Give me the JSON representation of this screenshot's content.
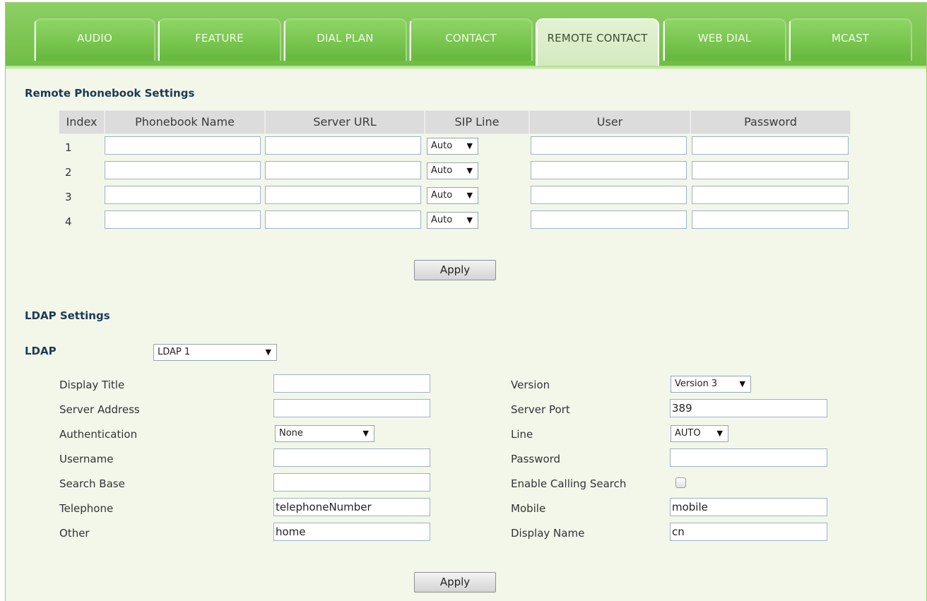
{
  "tabs": [
    "AUDIO",
    "FEATURE",
    "DIAL PLAN",
    "CONTACT",
    "REMOTE CONTACT",
    "WEB DIAL",
    "MCAST"
  ],
  "active_tab": "REMOTE CONTACT",
  "remote_phonebook": {
    "title": "Remote Phonebook Settings",
    "columns": [
      "Index",
      "Phonebook Name",
      "Server URL",
      "SIP Line",
      "User",
      "Password"
    ],
    "rows": [
      {
        "index": "1",
        "phonebook_name": "",
        "server_url": "",
        "sip_line": "Auto",
        "user": "",
        "password": ""
      },
      {
        "index": "2",
        "phonebook_name": "",
        "server_url": "",
        "sip_line": "Auto",
        "user": "",
        "password": ""
      },
      {
        "index": "3",
        "phonebook_name": "",
        "server_url": "",
        "sip_line": "Auto",
        "user": "",
        "password": ""
      },
      {
        "index": "4",
        "phonebook_name": "",
        "server_url": "",
        "sip_line": "Auto",
        "user": "",
        "password": ""
      }
    ],
    "apply_label": "Apply"
  },
  "ldap": {
    "title": "LDAP Settings",
    "selector_label": "LDAP",
    "selector_value": "LDAP 1",
    "display_title": {
      "label": "Display Title",
      "value": ""
    },
    "server_address": {
      "label": "Server Address",
      "value": ""
    },
    "authentication": {
      "label": "Authentication",
      "value": "None"
    },
    "username": {
      "label": "Username",
      "value": ""
    },
    "search_base": {
      "label": "Search Base",
      "value": ""
    },
    "telephone": {
      "label": "Telephone",
      "value": "telephoneNumber"
    },
    "other": {
      "label": "Other",
      "value": "home"
    },
    "version": {
      "label": "Version",
      "value": "Version 3"
    },
    "server_port": {
      "label": "Server Port",
      "value": "389"
    },
    "line": {
      "label": "Line",
      "value": "AUTO"
    },
    "password": {
      "label": "Password",
      "value": ""
    },
    "enable_calling_search": {
      "label": "Enable Calling Search",
      "checked": false
    },
    "mobile": {
      "label": "Mobile",
      "value": "mobile"
    },
    "display_name": {
      "label": "Display Name",
      "value": "cn"
    },
    "apply_label": "Apply"
  },
  "colors": {
    "tab_green": "#6fbc44",
    "active_tab": "#dcedcb",
    "page_bg": "#f2f7ea",
    "heading": "#1c3a55"
  },
  "icons": {
    "dropdown_arrow": "▼"
  }
}
